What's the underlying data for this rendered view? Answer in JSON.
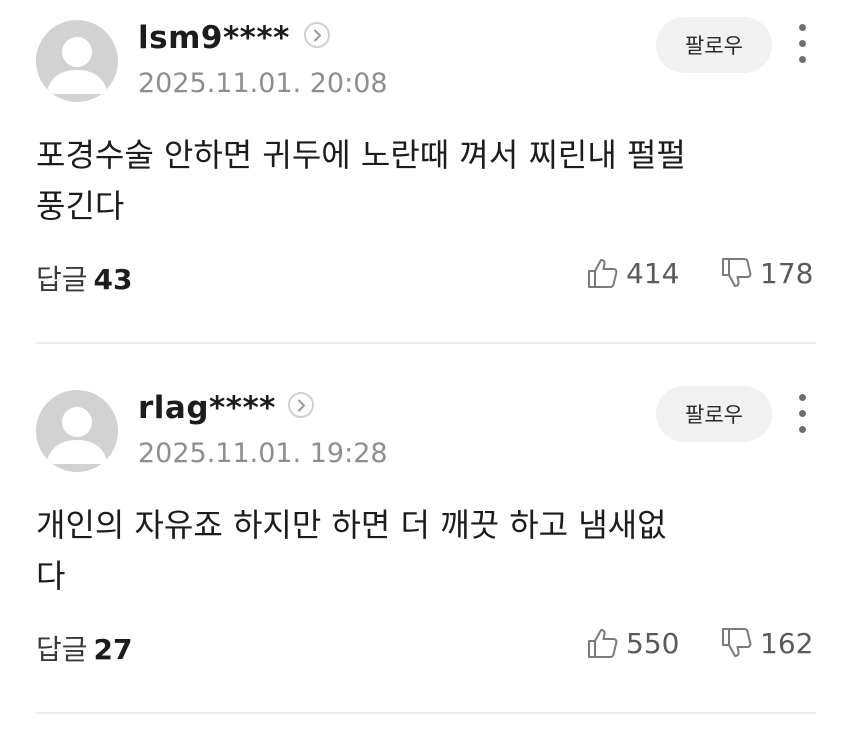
{
  "comments": [
    {
      "username": "lsm9****",
      "date": "2025.11.01. 20:08",
      "follow_label": "팔로우",
      "text": "포경수술 안하면 귀두에 노란때 껴서 찌린내 펄펄\n풍긴다",
      "replies_label": "답글",
      "replies_count": "43",
      "likes": "414",
      "dislikes": "178"
    },
    {
      "username": "rlag****",
      "date": "2025.11.01. 19:28",
      "follow_label": "팔로우",
      "text": "개인의 자유죠 하지만 하면 더 깨끗 하고 냄새없\n다",
      "replies_label": "답글",
      "replies_count": "27",
      "likes": "550",
      "dislikes": "162"
    }
  ],
  "colors": {
    "avatar_bg": "#d2d2d2",
    "avatar_fg": "#ffffff",
    "date_text": "#8e8e8e",
    "follow_bg": "#f1f1f1",
    "divider": "#ededed"
  },
  "icons": [
    "avatar-icon",
    "chevron-right-icon",
    "more-vertical-icon",
    "thumbs-up-icon",
    "thumbs-down-icon"
  ]
}
